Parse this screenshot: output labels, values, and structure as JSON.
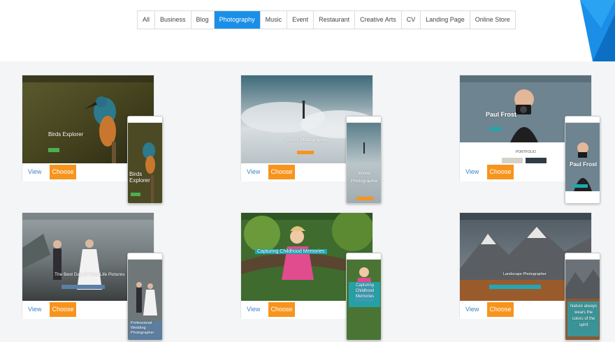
{
  "filter_tabs": [
    "All",
    "Business",
    "Blog",
    "Photography",
    "Music",
    "Event",
    "Restaurant",
    "Creative Arts",
    "CV",
    "Landing Page",
    "Online Store"
  ],
  "active_tab": "Photography",
  "accent_color": "#1b8fe8",
  "choose_color": "#f7941d",
  "actions": {
    "view_label": "View",
    "choose_label": "Choose"
  },
  "templates": [
    {
      "desktop_title": "Birds Explorer",
      "mobile_title": "Birds Explorer"
    },
    {
      "desktop_title": "Winter Photographer",
      "mobile_title": "Winter Photographer"
    },
    {
      "desktop_title": "Paul Frost",
      "mobile_title": "Paul Frost"
    },
    {
      "desktop_title": "The Best Day Of Your Life Pictures",
      "mobile_title": "Professional Wedding Photographer"
    },
    {
      "desktop_title": "Capturing Childhood Memories",
      "mobile_title": "Capturing Childhood Memories"
    },
    {
      "desktop_title": "Landscape Photographer",
      "mobile_title": "Nature always wears the colors of the spirit"
    }
  ]
}
